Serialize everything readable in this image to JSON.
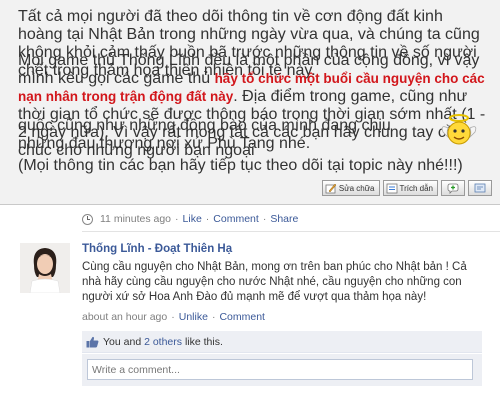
{
  "forum": {
    "paragraph1": "Tất cả mọi người đã theo dõi thông tin về cơn động đất kinh hoàng tại Nhật Bản trong những ngày vừa qua, và chúng ta cũng không khỏi cảm thấy buồn bã trước những thông tin về số người chết trong thảm họa thiên nhiên tồi tệ này.",
    "paragraph2_start": "Mọi game thủ Thống Lĩnh đều là một phần của cộng đồng, vì vậy mình kêu gọi các game thủ ",
    "paragraph2_highlight": "hãy tổ chức một buổi cầu nguyện cho các nạn nhân trong trận động đất này",
    "paragraph2_end": ". Địa điểm trong game, cũng như thời gian tổ chức sẽ được thông báo trong thời gian sớm nhất (1 - 2 ngày nữa). Vì vậy rất mong tất cả các bạn hãy chung tay cầu chúc cho những người bạn ngoại",
    "paragraph3": "quốc cũng như những đồng bào của mình đang chịu những đau thương nơi xứ Phù Tang nhé.",
    "paragraph4": "(Mọi thông tin các bạn hãy tiếp tục theo dõi tại topic này nhé!!!)",
    "buttons": {
      "edit": "Sửa chữa",
      "quote": "Trích dẫn"
    },
    "highlight_color": "#d2161b"
  },
  "fb_post": {
    "time": "11 minutes ago",
    "sep": "·",
    "like": "Like",
    "comment": "Comment",
    "share": "Share"
  },
  "comment": {
    "author": "Thống Lĩnh - Đoạt Thiên Hạ",
    "text": "Cùng cầu nguyện cho Nhật Bản, mong ơn trên ban phúc cho Nhật bản ! Cả nhà hãy cùng cầu nguyện cho nước Nhật nhé, cầu nguyện cho những con người xứ sở Hoa Anh Đào đủ mạnh mẽ để vượt qua thảm họa này!",
    "time": "about an hour ago",
    "sep": "·",
    "unlike": "Unlike",
    "comment_link": "Comment"
  },
  "likes": {
    "prefix": "You and ",
    "others": "2 others",
    "suffix": " like this."
  },
  "comment_box": {
    "placeholder": "Write a comment..."
  },
  "colors": {
    "fb_link": "#3b5998",
    "forum_bg": "#f2f2f2",
    "likes_bg": "#edeff4"
  }
}
